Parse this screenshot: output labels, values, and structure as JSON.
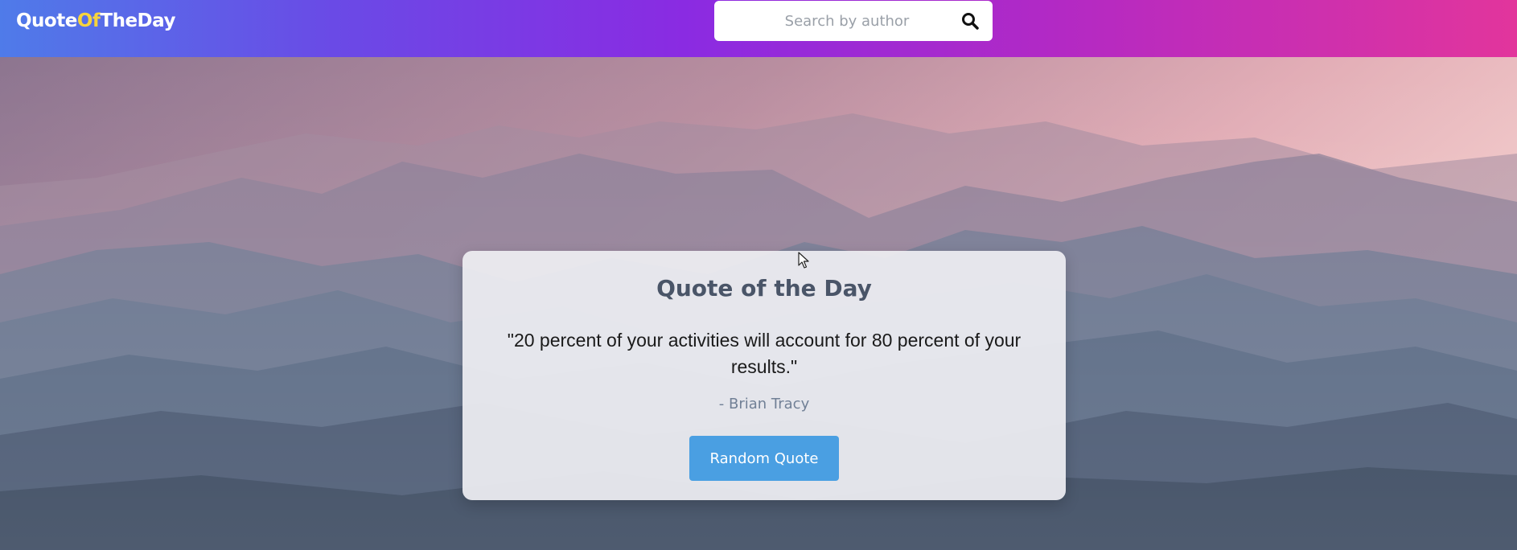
{
  "header": {
    "brand_part1": "Quote",
    "brand_part2": "Of",
    "brand_part3": "TheDay",
    "brand_accent_color": "#f6d33c",
    "gradient_colors": [
      "#4f7be9",
      "#8a2be2",
      "#e2359c"
    ]
  },
  "search": {
    "placeholder": "Search by author",
    "value": "",
    "icon": "search-icon"
  },
  "card": {
    "title": "Quote of the Day",
    "quote": "\"20 percent of your activities will account for 80 percent of your results.\"",
    "author": "- Brian Tracy",
    "button_label": "Random Quote",
    "button_color": "#4a9fe2"
  },
  "background": {
    "scene": "misty-mountains-icon"
  }
}
